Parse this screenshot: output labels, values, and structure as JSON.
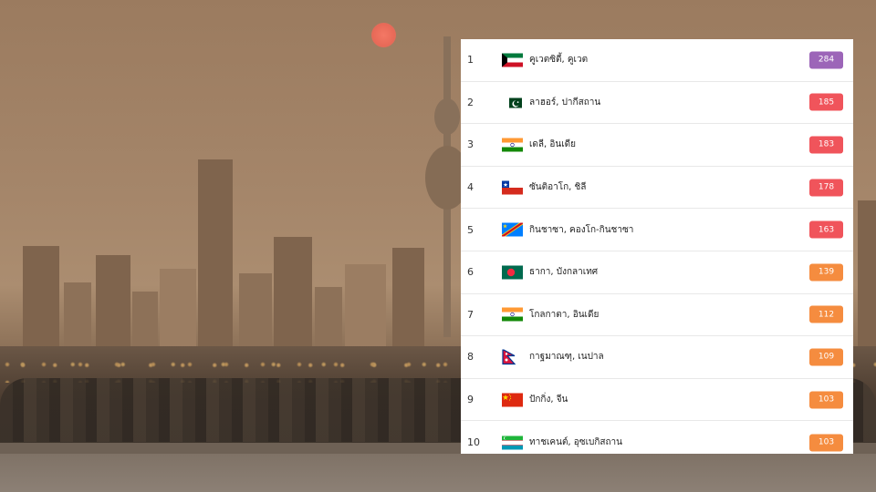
{
  "ranking": {
    "rows": [
      {
        "rank": "1",
        "flag": "kuwait-flag-icon",
        "city": "คูเวตซิตี้, คูเวต",
        "aqi": "284",
        "level": "purple"
      },
      {
        "rank": "2",
        "flag": "pakistan-flag-icon",
        "city": "ลาฮอร์, ปากีสถาน",
        "aqi": "185",
        "level": "red"
      },
      {
        "rank": "3",
        "flag": "india-flag-icon",
        "city": "เดลี, อินเดีย",
        "aqi": "183",
        "level": "red"
      },
      {
        "rank": "4",
        "flag": "chile-flag-icon",
        "city": "ซันติอาโก, ชิลี",
        "aqi": "178",
        "level": "red"
      },
      {
        "rank": "5",
        "flag": "dr-congo-flag-icon",
        "city": "กินชาซา, คองโก-กินชาซา",
        "aqi": "163",
        "level": "red"
      },
      {
        "rank": "6",
        "flag": "bangladesh-flag-icon",
        "city": "ธากา, บังกลาเทศ",
        "aqi": "139",
        "level": "orange"
      },
      {
        "rank": "7",
        "flag": "india-flag-icon",
        "city": "โกลกาตา, อินเดีย",
        "aqi": "112",
        "level": "orange"
      },
      {
        "rank": "8",
        "flag": "nepal-flag-icon",
        "city": "กาฐมาณฑุ, เนปาล",
        "aqi": "109",
        "level": "orange"
      },
      {
        "rank": "9",
        "flag": "china-flag-icon",
        "city": "ปักกิ่ง, จีน",
        "aqi": "103",
        "level": "orange"
      },
      {
        "rank": "10",
        "flag": "uzbekistan-flag-icon",
        "city": "ทาชเคนต์, อุซเบกิสถาน",
        "aqi": "103",
        "level": "orange"
      }
    ]
  },
  "colors": {
    "purple": "#9c65b8",
    "red": "#f0545b",
    "orange": "#f58c3f"
  }
}
